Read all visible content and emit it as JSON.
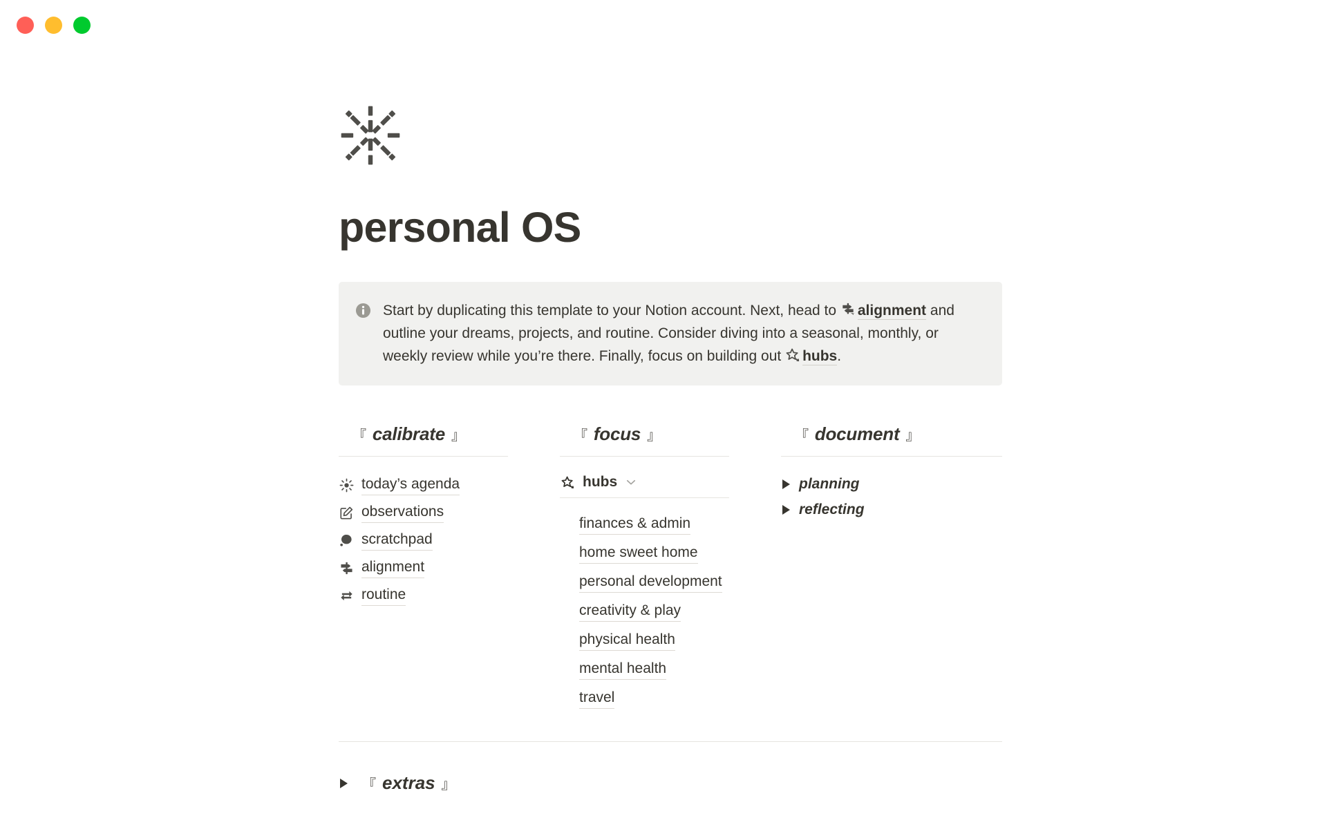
{
  "window": {
    "controls": [
      {
        "name": "close",
        "color": "#ff5f57"
      },
      {
        "name": "minimize",
        "color": "#ffbd2e"
      },
      {
        "name": "maximize",
        "color": "#00ca2e"
      }
    ]
  },
  "page": {
    "icon": "sunburst-sparkle-icon",
    "title": "personal OS"
  },
  "callout": {
    "icon": "info-icon",
    "segment_1": "Start by duplicating this template to your Notion account. Next, head to ",
    "link_1": {
      "icon": "signpost-icon",
      "label": "alignment"
    },
    "segment_2": " and outline your dreams, projects, and routine. Consider diving into a seasonal, monthly, or weekly review while you’re there. Finally, focus on building out ",
    "link_2": {
      "icon": "star-icon",
      "label": "hubs"
    },
    "segment_3": "."
  },
  "columns": [
    {
      "key": "calibrate",
      "bracket_open": "『",
      "bracket_close": "』",
      "title": "calibrate",
      "items": [
        {
          "icon": "sun-icon",
          "label": "today’s agenda"
        },
        {
          "icon": "edit-square-icon",
          "label": "observations"
        },
        {
          "icon": "thought-blob-icon",
          "label": "scratchpad"
        },
        {
          "icon": "signpost-icon",
          "label": "alignment"
        },
        {
          "icon": "repeat-icon",
          "label": "routine"
        }
      ]
    },
    {
      "key": "focus",
      "bracket_open": "『",
      "bracket_close": "』",
      "title": "focus",
      "toggle": {
        "icon": "star-icon",
        "label": "hubs",
        "chevron": "chevron-down-icon",
        "expanded": true
      },
      "items": [
        {
          "label": "finances & admin"
        },
        {
          "label": "home sweet home"
        },
        {
          "label": "personal development"
        },
        {
          "label": "creativity & play"
        },
        {
          "label": "physical health"
        },
        {
          "label": "mental health"
        },
        {
          "label": "travel"
        }
      ]
    },
    {
      "key": "document",
      "bracket_open": "『",
      "bracket_close": "』",
      "title": "document",
      "toggles": [
        {
          "label": "planning",
          "marker": "triangle-right-icon"
        },
        {
          "label": "reflecting",
          "marker": "triangle-right-icon"
        }
      ]
    }
  ],
  "extras": {
    "marker": "triangle-right-icon",
    "bracket_open": "『",
    "bracket_close": "』",
    "title": "extras"
  },
  "colors": {
    "text": "#37352f",
    "callout_bg": "#f1f1ef",
    "rule": "#e6e4e0",
    "underline": "#ddd9d3"
  }
}
